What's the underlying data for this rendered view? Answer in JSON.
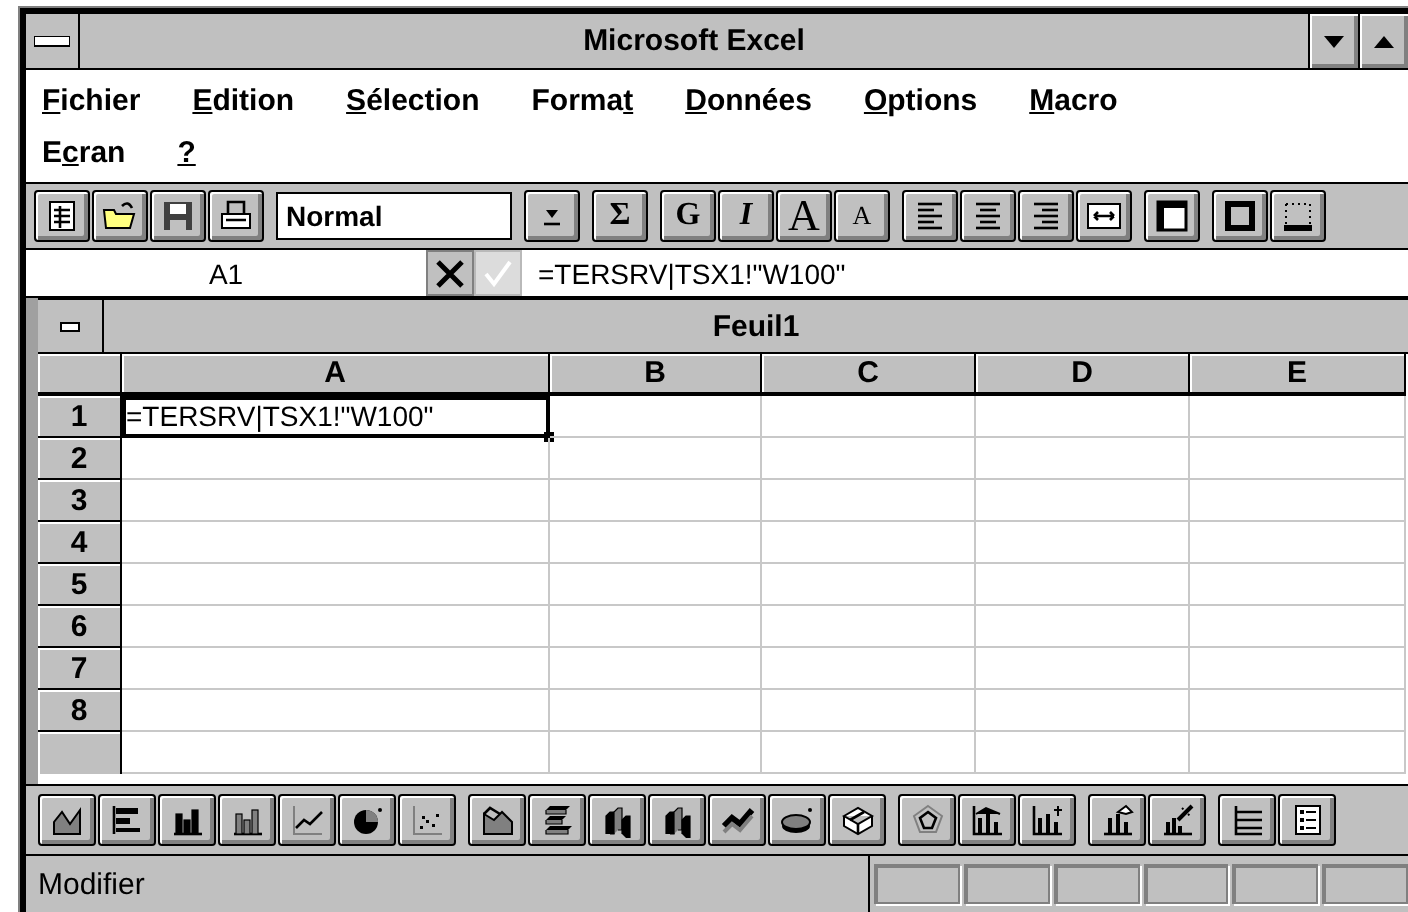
{
  "window": {
    "title": "Microsoft Excel"
  },
  "menu_rows": [
    [
      {
        "key": "F",
        "after": "ichier"
      },
      {
        "key": "E",
        "after": "dition"
      },
      {
        "key": "S",
        "after": "élection"
      },
      {
        "before": "Forma",
        "key": "t"
      },
      {
        "key": "D",
        "after": "onnées"
      },
      {
        "key": "O",
        "after": "ptions"
      },
      {
        "key": "M",
        "after": "acro"
      }
    ],
    [
      {
        "before": "E",
        "key": "c",
        "after": "ran"
      },
      {
        "key": "?"
      }
    ]
  ],
  "toolbar": {
    "style_box": {
      "value": "Normal"
    },
    "groups": [
      [
        {
          "kind": "new"
        },
        {
          "kind": "open"
        },
        {
          "kind": "save"
        },
        {
          "kind": "print"
        }
      ],
      [
        {
          "kind": "combo"
        }
      ],
      [
        {
          "kind": "dropdown"
        }
      ],
      [
        {
          "kind": "sum",
          "label": "Σ"
        }
      ],
      [
        {
          "kind": "bold",
          "label": "G"
        },
        {
          "kind": "italic",
          "label": "I"
        },
        {
          "kind": "grow",
          "label": "A"
        },
        {
          "kind": "shrink",
          "label": "A"
        }
      ],
      [
        {
          "kind": "left"
        },
        {
          "kind": "center"
        },
        {
          "kind": "right"
        },
        {
          "kind": "across"
        }
      ],
      [
        {
          "kind": "frame"
        }
      ],
      [
        {
          "kind": "outline"
        },
        {
          "kind": "bottom"
        }
      ]
    ]
  },
  "formula_bar": {
    "cell_ref": "A1",
    "cancel_enabled": true,
    "confirm_enabled": false,
    "formula": "=TERSRV|TSX1!\"W100\""
  },
  "sheet": {
    "title": "Feuil1",
    "columns": [
      "A",
      "B",
      "C",
      "D",
      "E"
    ],
    "rows": [
      {
        "label": "1",
        "cells": [
          "=TERSRV|TSX1!\"W100\"",
          "",
          "",
          "",
          ""
        ],
        "selected": true
      },
      {
        "label": "2",
        "selected": false
      },
      {
        "label": "3",
        "selected": false
      },
      {
        "label": "4",
        "selected": false
      },
      {
        "label": "5",
        "selected": false
      },
      {
        "label": "6",
        "selected": false
      },
      {
        "label": "7",
        "selected": false
      },
      {
        "label": "8",
        "selected": false
      }
    ]
  },
  "chart_toolbar": [
    [
      {
        "kind": "area"
      },
      {
        "kind": "bar"
      },
      {
        "kind": "column"
      },
      {
        "kind": "stacked-column"
      },
      {
        "kind": "line"
      },
      {
        "kind": "pie"
      },
      {
        "kind": "scatter"
      }
    ],
    [
      {
        "kind": "area3d"
      },
      {
        "kind": "bar3d"
      },
      {
        "kind": "column3d"
      },
      {
        "kind": "persp3d"
      },
      {
        "kind": "line3d"
      },
      {
        "kind": "pie3d"
      },
      {
        "kind": "surface3d"
      }
    ],
    [
      {
        "kind": "radar"
      },
      {
        "kind": "combo"
      },
      {
        "kind": "combo2"
      }
    ],
    [
      {
        "kind": "preferred"
      },
      {
        "kind": "wizard"
      }
    ],
    [
      {
        "kind": "gridlines"
      },
      {
        "kind": "legend"
      }
    ]
  ],
  "status_bar": {
    "message": "Modifier"
  }
}
